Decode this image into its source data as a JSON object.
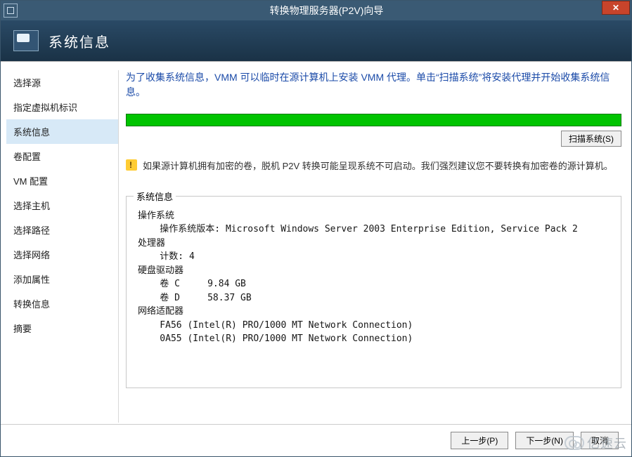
{
  "window": {
    "title": "转换物理服务器(P2V)向导"
  },
  "header": {
    "title": "系统信息"
  },
  "sidebar": {
    "items": [
      {
        "label": "选择源"
      },
      {
        "label": "指定虚拟机标识"
      },
      {
        "label": "系统信息",
        "selected": true
      },
      {
        "label": "卷配置"
      },
      {
        "label": "VM 配置"
      },
      {
        "label": "选择主机"
      },
      {
        "label": "选择路径"
      },
      {
        "label": "选择网络"
      },
      {
        "label": "添加属性"
      },
      {
        "label": "转换信息"
      },
      {
        "label": "摘要"
      }
    ]
  },
  "main": {
    "intro": "为了收集系统信息，VMM 可以临时在源计算机上安装 VMM 代理。单击“扫描系统”将安装代理并开始收集系统信息。",
    "scan_button": "扫描系统(S)",
    "warning": "如果源计算机拥有加密的卷，脱机 P2V 转换可能呈现系统不可启动。我们强烈建议您不要转换有加密卷的源计算机。",
    "group_title": "系统信息",
    "sysinfo": {
      "os_heading": "操作系统",
      "os_version_label": "操作系统版本",
      "os_version": "Microsoft Windows Server 2003 Enterprise Edition, Service Pack 2",
      "cpu_heading": "处理器",
      "cpu_count_label": "计数",
      "cpu_count": "4",
      "disk_heading": "硬盘驱动器",
      "volumes": [
        {
          "name": "卷 C",
          "size": "9.84 GB"
        },
        {
          "name": "卷 D",
          "size": "58.37 GB"
        }
      ],
      "net_heading": "网络适配器",
      "adapters": [
        {
          "id": "FA56",
          "desc": "(Intel(R) PRO/1000 MT Network Connection)"
        },
        {
          "id": "0A55",
          "desc": "(Intel(R) PRO/1000 MT Network Connection)"
        }
      ]
    }
  },
  "footer": {
    "prev": "上一步(P)",
    "next": "下一步(N)",
    "cancel": "取消"
  },
  "watermark": "亿速云"
}
